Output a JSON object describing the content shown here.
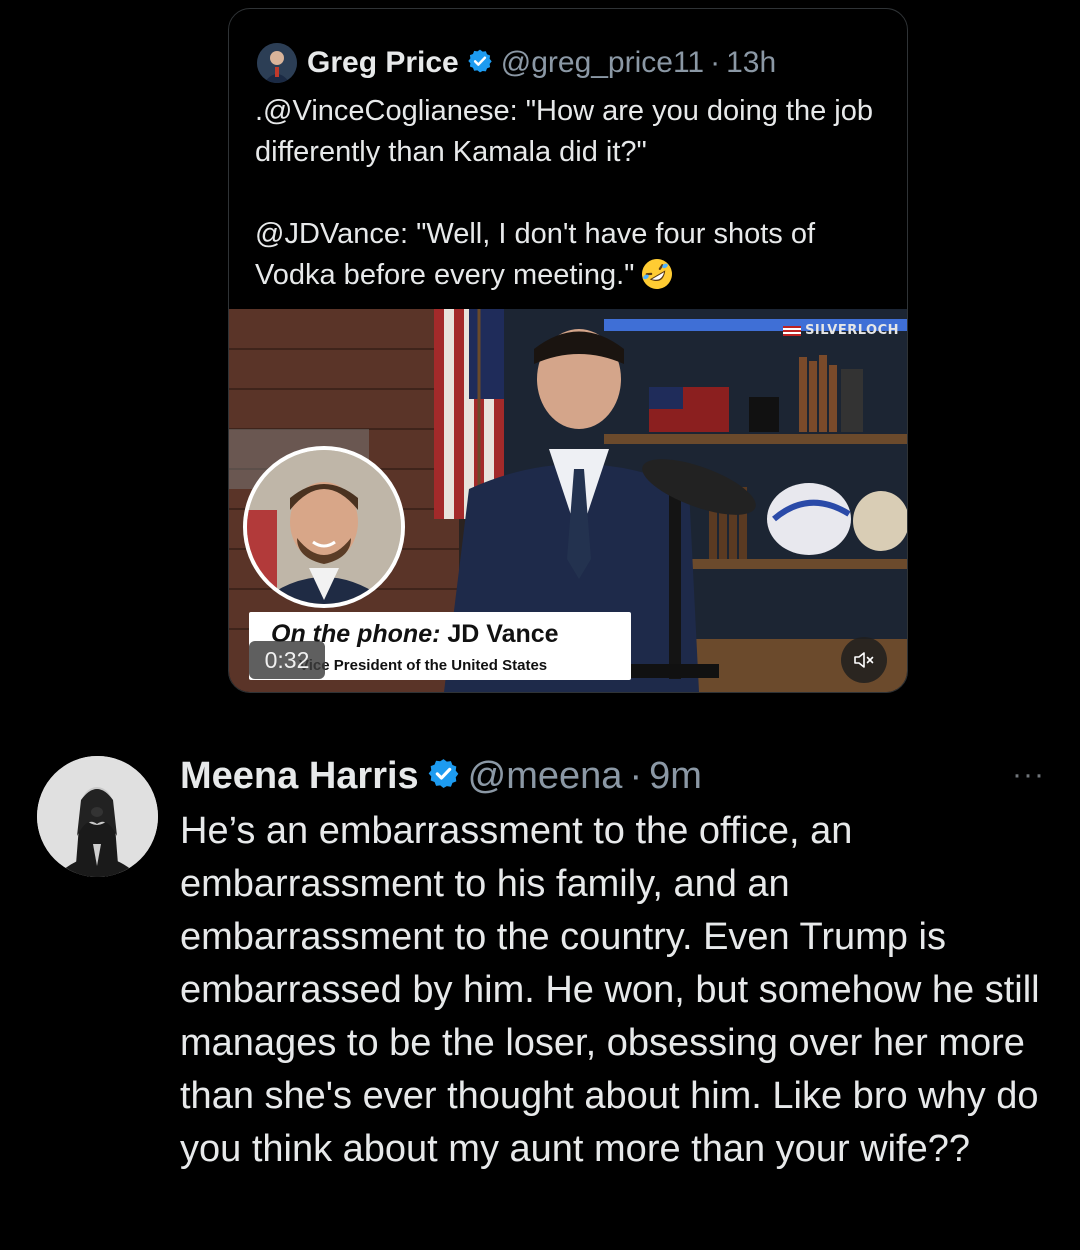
{
  "quoted_tweet": {
    "author_name": "Greg Price",
    "handle": "@greg_price11",
    "separator": "·",
    "time": "13h",
    "text_line1": ".@VinceCoglianese: \"How are you doing the job differently than Kamala did it?\"",
    "text_line2": "@JDVance: \"Well, I don't have four shots of Vodka before every meeting.\"",
    "emoji_icon": "rolling-on-floor-laughing-emoji",
    "video": {
      "watermark": "SILVERLOCH",
      "lower_third_label": "On the phone:",
      "lower_third_name": "JD Vance",
      "lower_third_subtitle": "Vice President of the United States",
      "timer": "0:32",
      "mute_icon": "speaker-muted-icon"
    }
  },
  "main_tweet": {
    "author_name": "Meena Harris",
    "handle": "@meena",
    "separator": "·",
    "time": "9m",
    "more_label": "···",
    "text": "He’s an embarrassment to the office, an embarrassment to his family, and an embarrassment to the country. Even Trump is embarrassed by him. He won, but somehow he still manages to be the loser, obsessing over her more than she's ever thought about him. Like bro why do you think about my aunt more than your wife??"
  },
  "colors": {
    "background": "#000000",
    "text": "#e7e9ea",
    "secondary_text": "#8b98a5",
    "verified_blue": "#1d9bf0",
    "border": "#2f3336"
  }
}
